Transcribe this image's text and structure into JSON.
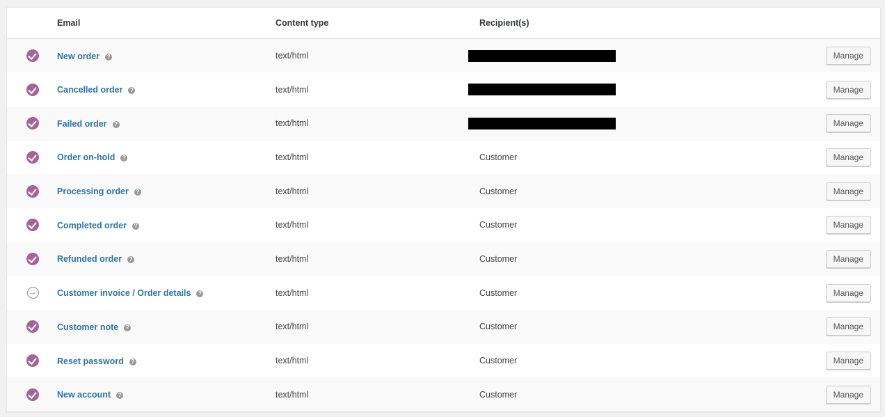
{
  "table": {
    "headers": {
      "status": "",
      "email": "Email",
      "content_type": "Content type",
      "recipients": "Recipient(s)"
    },
    "manage_label": "Manage",
    "rows": [
      {
        "status": "enabled",
        "name": "New order",
        "content_type": "text/html",
        "recipient": "",
        "redacted": true
      },
      {
        "status": "enabled",
        "name": "Cancelled order",
        "content_type": "text/html",
        "recipient": "",
        "redacted": true
      },
      {
        "status": "enabled",
        "name": "Failed order",
        "content_type": "text/html",
        "recipient": "",
        "redacted": true
      },
      {
        "status": "enabled",
        "name": "Order on-hold",
        "content_type": "text/html",
        "recipient": "Customer",
        "redacted": false
      },
      {
        "status": "enabled",
        "name": "Processing order",
        "content_type": "text/html",
        "recipient": "Customer",
        "redacted": false
      },
      {
        "status": "enabled",
        "name": "Completed order",
        "content_type": "text/html",
        "recipient": "Customer",
        "redacted": false
      },
      {
        "status": "enabled",
        "name": "Refunded order",
        "content_type": "text/html",
        "recipient": "Customer",
        "redacted": false
      },
      {
        "status": "manual",
        "name": "Customer invoice / Order details",
        "content_type": "text/html",
        "recipient": "Customer",
        "redacted": false
      },
      {
        "status": "enabled",
        "name": "Customer note",
        "content_type": "text/html",
        "recipient": "Customer",
        "redacted": false
      },
      {
        "status": "enabled",
        "name": "Reset password",
        "content_type": "text/html",
        "recipient": "Customer",
        "redacted": false
      },
      {
        "status": "enabled",
        "name": "New account",
        "content_type": "text/html",
        "recipient": "Customer",
        "redacted": false
      }
    ]
  },
  "icons": {
    "enabled": "check-circle-icon",
    "manual": "arrow-circle-right-icon",
    "help": "help-icon"
  },
  "colors": {
    "enabled_status": "#a46497",
    "link": "#2e74a6"
  }
}
